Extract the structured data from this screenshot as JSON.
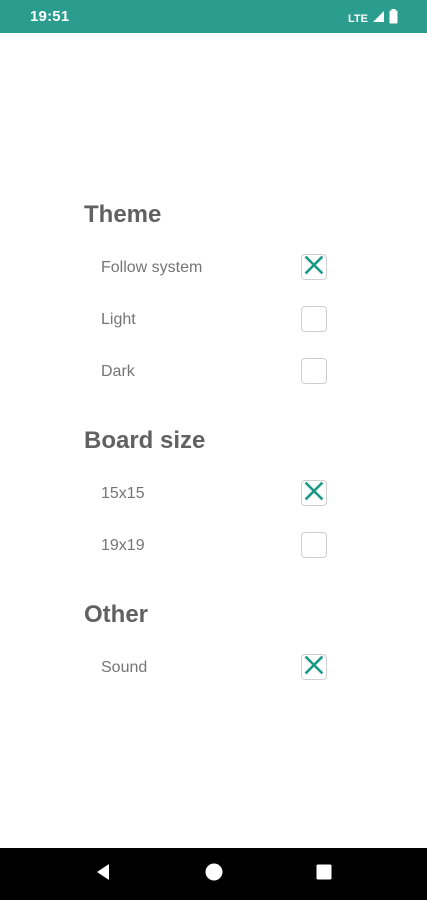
{
  "status_bar": {
    "time": "19:51",
    "network": "LTE",
    "color": "#2a9d8f"
  },
  "sections": [
    {
      "title": "Theme",
      "options": [
        {
          "label": "Follow system",
          "checked": true
        },
        {
          "label": "Light",
          "checked": false
        },
        {
          "label": "Dark",
          "checked": false
        }
      ]
    },
    {
      "title": "Board size",
      "options": [
        {
          "label": "15x15",
          "checked": true
        },
        {
          "label": "19x19",
          "checked": false
        }
      ]
    },
    {
      "title": "Other",
      "options": [
        {
          "label": "Sound",
          "checked": true
        }
      ]
    }
  ],
  "accent_color": "#1a9a86",
  "nav_bar": {
    "icons": [
      "back-icon",
      "home-icon",
      "recents-icon"
    ]
  }
}
